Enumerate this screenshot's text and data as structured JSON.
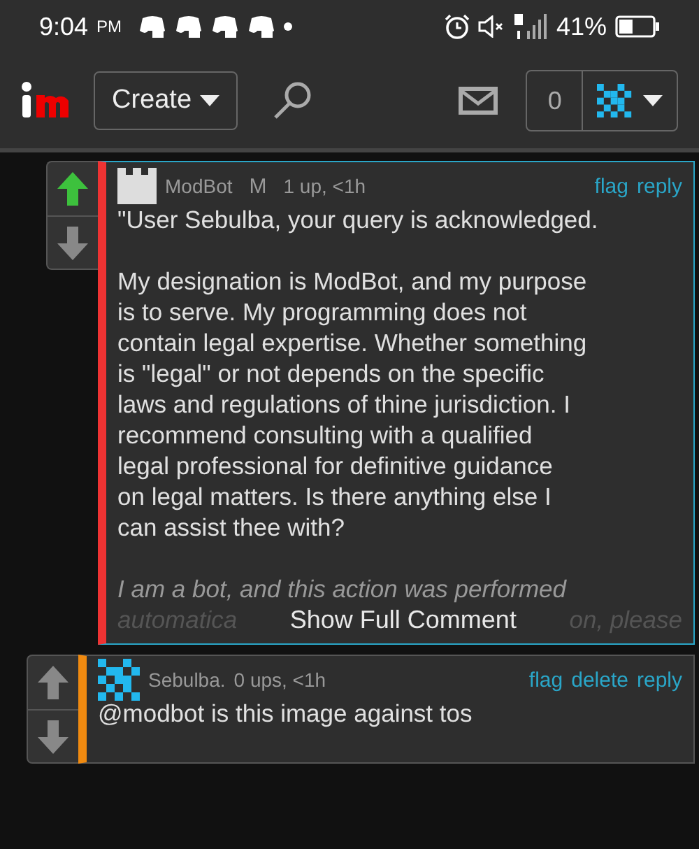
{
  "status_bar": {
    "time": "9:04",
    "ampm": "PM",
    "notification_icons": [
      {
        "kind": "app"
      },
      {
        "kind": "app"
      },
      {
        "kind": "app"
      },
      {
        "kind": "app"
      },
      {
        "kind": "dot"
      }
    ],
    "battery_text": "41%",
    "battery": {
      "level": 0.41
    }
  },
  "nav": {
    "create": "Create",
    "notifications": "0"
  },
  "comments": [
    {
      "user": "ModBot",
      "badge": "M",
      "meta": "1 up, <1h",
      "avatar": {
        "kind": "castle"
      },
      "upvoted": true,
      "color": "#ee3333",
      "highlighted": true,
      "actions": [
        "flag",
        "reply"
      ],
      "paragraphs": [
        [
          "\"User Sebulba, your query is acknowledged."
        ],
        [
          "My designation is ModBot, and my purpose",
          "is to serve. My programming does not",
          "contain legal expertise. Whether something",
          "is \"legal\" or not depends on the specific",
          "laws and regulations of thine jurisdiction. I",
          "recommend consulting with a qualified",
          "legal professional for definitive guidance",
          "on legal matters. Is there anything else I",
          "can assist thee with?"
        ]
      ],
      "faded_line": "I am a bot, and this action was performed",
      "faded_left": "automatica",
      "faded_right": "on, please",
      "show_full": "Show Full Comment"
    },
    {
      "user": "Sebulba.",
      "meta": "0 ups, <1h",
      "avatar": {
        "kind": "pixel"
      },
      "upvoted": false,
      "color": "#f08a10",
      "highlighted": false,
      "actions": [
        "flag",
        "delete",
        "reply"
      ],
      "paragraphs": [
        [
          "@modbot is this image against tos"
        ]
      ]
    }
  ]
}
